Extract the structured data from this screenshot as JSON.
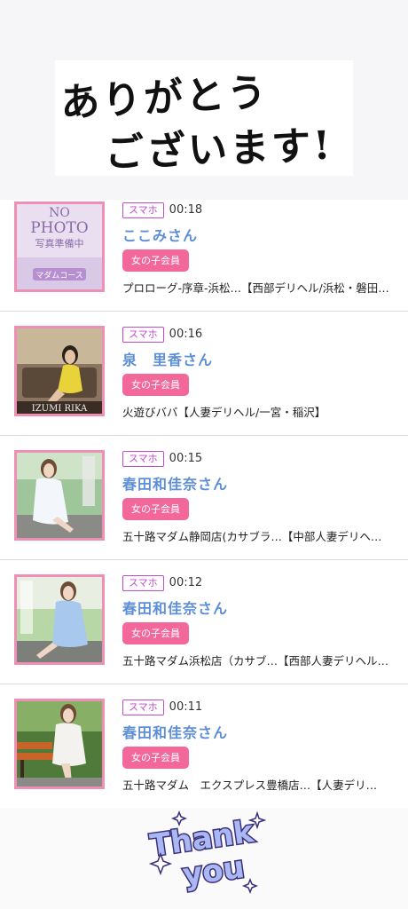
{
  "header": {
    "line1": "ありがとう",
    "line2": "ございます!"
  },
  "rows": [
    {
      "badge": "スマホ",
      "time": "00:18",
      "name": "ここみさん",
      "member": "女の子会員",
      "shop": "プロローグ-序章-浜松…【西部デリヘル/浜松・磐田…",
      "thumb": {
        "line1": "NO",
        "line2": "PHOTO",
        "line3": "写真準備中",
        "line4": "マダムコース"
      }
    },
    {
      "badge": "スマホ",
      "time": "00:16",
      "name": "泉　里香さん",
      "member": "女の子会員",
      "shop": "火遊びババ【人妻デリヘル/一宮・稲沢】",
      "thumb": {
        "caption": "IZUMI RIKA"
      }
    },
    {
      "badge": "スマホ",
      "time": "00:15",
      "name": "春田和佳奈さん",
      "member": "女の子会員",
      "shop": "五十路マダム静岡店(カサブラ…【中部人妻デリヘ…"
    },
    {
      "badge": "スマホ",
      "time": "00:12",
      "name": "春田和佳奈さん",
      "member": "女の子会員",
      "shop": "五十路マダム浜松店（カサブ…【西部人妻デリヘル…"
    },
    {
      "badge": "スマホ",
      "time": "00:11",
      "name": "春田和佳奈さん",
      "member": "女の子会員",
      "shop": "五十路マダム　エクスプレス豊橋店…【人妻デリ…"
    }
  ],
  "footer": {
    "sticker_line1": "Thank",
    "sticker_line2": "you"
  },
  "colors": {
    "accent_pink": "#f2689b",
    "badge_purple": "#c44ad0",
    "name_blue": "#5d8fd8",
    "thumb_border": "#f08fb5"
  }
}
